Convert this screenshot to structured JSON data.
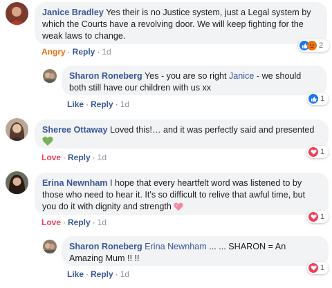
{
  "comments": [
    {
      "author": "Janice Bradley",
      "text": " Yes their is no Justice system, just a Legal system by which the Courts have a revolving door. We will keep fighting for the weak laws to change.",
      "reaction_label": "Angry",
      "reply_label": "Reply",
      "time": "1d",
      "reaction_count": "2",
      "reactions": [
        "like-icon",
        "angry-icon"
      ]
    },
    {
      "author": "Sharon Roneberg",
      "text_before": " Yes - you are so right ",
      "mention": "Janice",
      "text_after": " - we should both still have our children with us xx",
      "reaction_label": "Like",
      "reply_label": "Reply",
      "time": "1d",
      "reaction_count": "1",
      "reactions": [
        "like-icon"
      ]
    },
    {
      "author": "Sheree Ottaway",
      "text": " Loved this!… and it was perfectly said and presented",
      "emoji": "green-heart-icon",
      "reaction_label": "Love",
      "reply_label": "Reply",
      "time": "1d",
      "reaction_count": "1",
      "reactions": [
        "love-icon"
      ]
    },
    {
      "author": "Erina Newnham",
      "text": " I hope that every heartfelt word was listened to by those who need to hear it. It's so difficult to relive that awful time, but you do it with dignity and strength",
      "emoji": "sparkling-heart-icon",
      "reaction_label": "Love",
      "reply_label": "Reply",
      "time": "1d",
      "reaction_count": "1",
      "reactions": [
        "love-icon"
      ]
    },
    {
      "author": "Sharon Roneberg",
      "mention": "Erina Newnham",
      "text": " ... ... SHARON = An Amazing Mum !! !!",
      "reaction_label": "Like",
      "reply_label": "Reply",
      "time": "1d",
      "reaction_count": "1",
      "reactions": [
        "love-icon"
      ]
    }
  ],
  "separator": "·",
  "colors": {
    "link": "#385898",
    "angry": "#e9710f",
    "love": "#f33e58",
    "bubble": "#f2f3f5",
    "like_badge": "#1877f2"
  }
}
